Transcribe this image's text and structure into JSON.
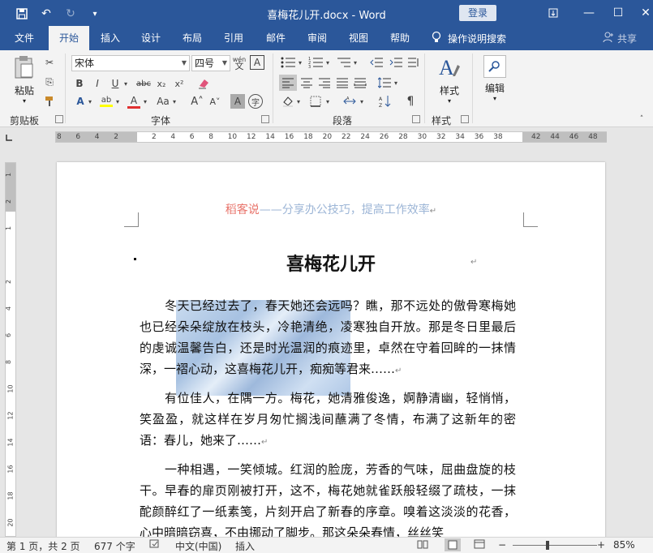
{
  "window": {
    "title": "喜梅花儿开.docx  -  Word",
    "login": "登录",
    "qat": [
      "save-icon",
      "undo-icon",
      "redo-icon",
      "customize-icon"
    ]
  },
  "tabs": [
    {
      "label": "文件"
    },
    {
      "label": "开始"
    },
    {
      "label": "插入"
    },
    {
      "label": "设计"
    },
    {
      "label": "布局"
    },
    {
      "label": "引用"
    },
    {
      "label": "邮件"
    },
    {
      "label": "审阅"
    },
    {
      "label": "视图"
    },
    {
      "label": "帮助"
    }
  ],
  "tell_me": "操作说明搜索",
  "share": "共享",
  "ribbon": {
    "clipboard": {
      "label": "剪贴板",
      "paste": "粘贴"
    },
    "font": {
      "label": "字体",
      "font_name": "宋体",
      "font_size": "四号",
      "phonetic": "wén"
    },
    "paragraph": {
      "label": "段落"
    },
    "styles": {
      "label": "样式",
      "button": "样式"
    },
    "editing": {
      "button": "编辑"
    }
  },
  "ruler": {
    "h_ticks": [
      "8",
      "6",
      "4",
      "2",
      "",
      "2",
      "4",
      "6",
      "8",
      "10",
      "12",
      "14",
      "16",
      "18",
      "20",
      "22",
      "24",
      "26",
      "28",
      "30",
      "32",
      "34",
      "36",
      "38",
      "",
      "42",
      "44",
      "46",
      "48"
    ],
    "v_ticks": [
      "1",
      "2",
      "1",
      "",
      "2",
      "4",
      "6",
      "8",
      "10",
      "12",
      "14",
      "16",
      "18",
      "20"
    ]
  },
  "document": {
    "header_a": "稻客说",
    "header_b": "——分享办公技巧，提高工作效率",
    "title": "喜梅花儿开",
    "p1": "冬天已经过去了，春天她还会远吗？瞧，那不远处的傲骨寒梅她也已经朵朵绽放在枝头，冷艳清绝，凌寒独自开放。那是冬日里最后的虔诚温馨告白，还是时光温润的痕迹里，卓然在守着回眸的一抹情深，一褶心动，这喜梅花儿开，痴痴等君来……",
    "p2": "有位佳人，在隅一方。梅花，她清雅俊逸，婀静清幽，轻悄悄，笑盈盈，就这样在岁月匆忙搁浅间蘸满了冬情，布满了这新年的密语：春儿，她来了……",
    "p3": "一种相遇，一笑倾城。红润的脸庞，芳香的气味，屈曲盘旋的枝干。早春的扉页刚被打开，这不，梅花她就雀跃般轻缀了疏枝，一抹酡颜醉红了一纸素笺，片刻开启了新春的序章。嗅着这淡淡的花香，心中暗暗窃喜，不由挪动了脚步。那这朵朵春情，丝丝笑"
  },
  "status": {
    "page": "第 1 页，共 2 页",
    "words": "677 个字",
    "lang": "中文(中国)",
    "mode": "插入",
    "zoom": "85%",
    "zoom_value": 85
  }
}
